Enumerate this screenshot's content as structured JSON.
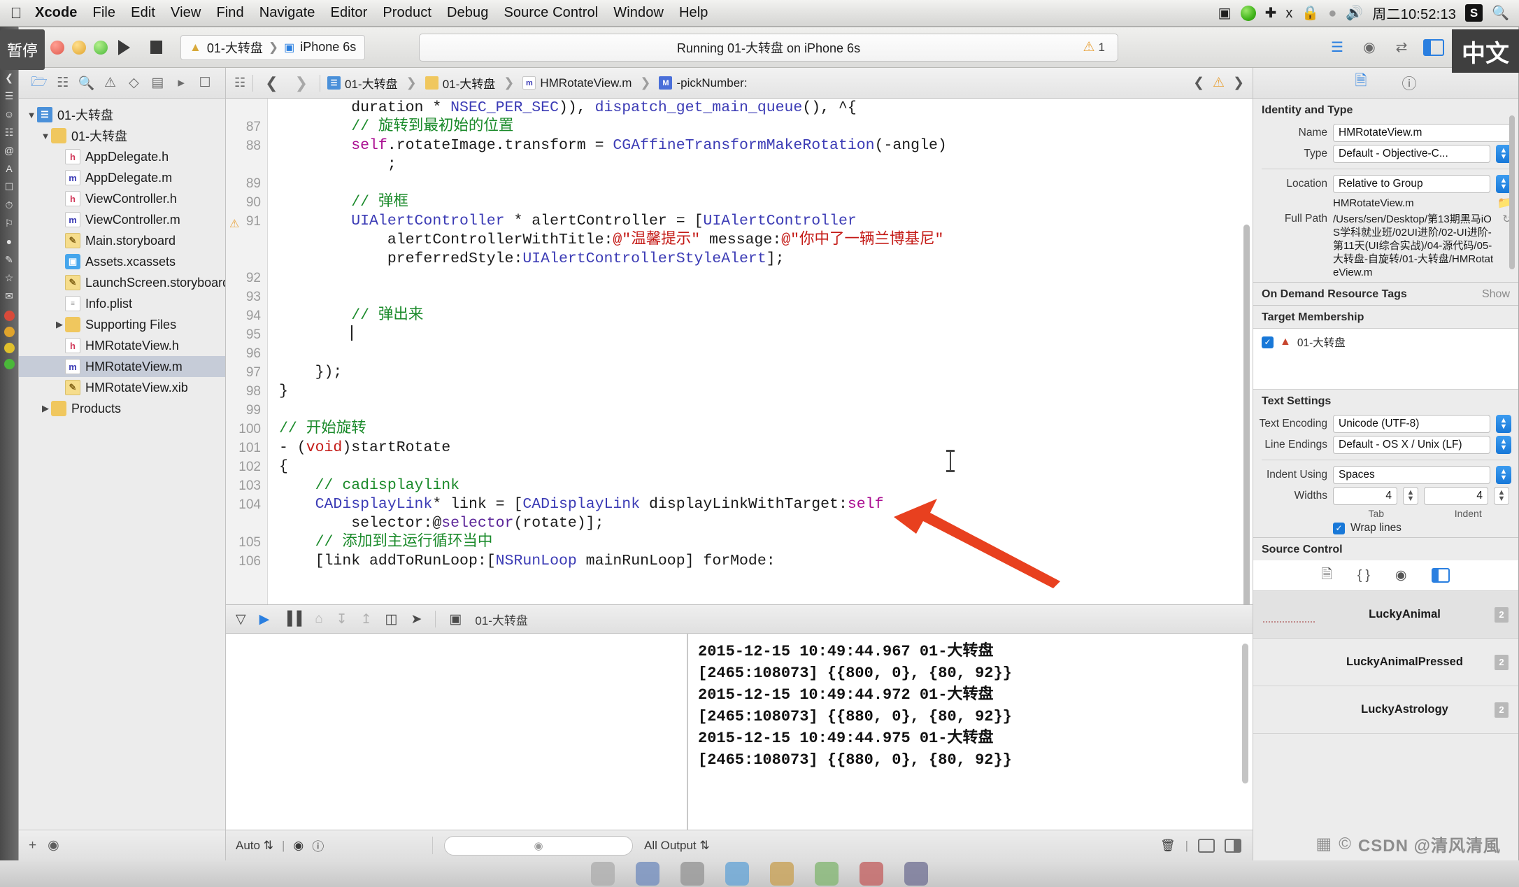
{
  "menubar": {
    "apple_icon": "apple-icon",
    "items": [
      "Xcode",
      "File",
      "Edit",
      "View",
      "Find",
      "Navigate",
      "Editor",
      "Product",
      "Debug",
      "Source Control",
      "Window",
      "Help"
    ],
    "status_icons": [
      "screen-record-icon",
      "play-circle-icon",
      "airplay-icon",
      "bluetooth-icon",
      "lock-icon",
      "location-icon",
      "volume-icon"
    ],
    "clock": "周二10:52:13",
    "ime_badge": "S",
    "search_icon": "search-icon"
  },
  "pause_tooltip": "暂停",
  "ime_overlay": "中文",
  "toolbar": {
    "run_button": "run-button",
    "stop_button": "stop-button",
    "scheme_target": "01-大转盘",
    "scheme_device": "iPhone 6s",
    "status_text": "Running 01-大转盘 on iPhone 6s",
    "warning_count": "1",
    "editor_icons": [
      "standard-editor-icon",
      "assistant-editor-icon",
      "version-editor-icon"
    ],
    "panel_icons": [
      "toggle-navigator-icon",
      "toggle-debug-icon",
      "toggle-inspector-icon"
    ]
  },
  "navigator": {
    "tabs": [
      "folder-icon",
      "source-control-icon",
      "search-icon",
      "warning-icon",
      "test-icon",
      "debug-icon",
      "breakpoint-icon",
      "report-icon"
    ],
    "active_tab": 0,
    "items": [
      {
        "label": "01-大转盘",
        "icon": "project-icon",
        "indent": 0,
        "twisty": "▼",
        "selected": false
      },
      {
        "label": "01-大转盘",
        "icon": "folder-icon",
        "indent": 1,
        "twisty": "▼",
        "selected": false
      },
      {
        "label": "AppDelegate.h",
        "icon": "header-icon",
        "indent": 2,
        "twisty": "",
        "selected": false
      },
      {
        "label": "AppDelegate.m",
        "icon": "objc-icon",
        "indent": 2,
        "twisty": "",
        "selected": false
      },
      {
        "label": "ViewController.h",
        "icon": "header-icon",
        "indent": 2,
        "twisty": "",
        "selected": false
      },
      {
        "label": "ViewController.m",
        "icon": "objc-icon",
        "indent": 2,
        "twisty": "",
        "selected": false
      },
      {
        "label": "Main.storyboard",
        "icon": "storyboard-icon",
        "indent": 2,
        "twisty": "",
        "selected": false
      },
      {
        "label": "Assets.xcassets",
        "icon": "assets-icon",
        "indent": 2,
        "twisty": "",
        "selected": false
      },
      {
        "label": "LaunchScreen.storyboard",
        "icon": "storyboard-icon",
        "indent": 2,
        "twisty": "",
        "selected": false
      },
      {
        "label": "Info.plist",
        "icon": "plist-icon",
        "indent": 2,
        "twisty": "",
        "selected": false
      },
      {
        "label": "Supporting Files",
        "icon": "folder-icon",
        "indent": 2,
        "twisty": "▶",
        "selected": false
      },
      {
        "label": "HMRotateView.h",
        "icon": "header-icon",
        "indent": 2,
        "twisty": "",
        "selected": false
      },
      {
        "label": "HMRotateView.m",
        "icon": "objc-icon",
        "indent": 2,
        "twisty": "",
        "selected": true
      },
      {
        "label": "HMRotateView.xib",
        "icon": "xib-icon",
        "indent": 2,
        "twisty": "",
        "selected": false
      },
      {
        "label": "Products",
        "icon": "folder-icon",
        "indent": 1,
        "twisty": "▶",
        "selected": false
      }
    ],
    "footer_icons": [
      "add-icon",
      "filter-icon"
    ]
  },
  "jumpbar": {
    "related_icon": "related-items-icon",
    "back_icon": "back-chevron-icon",
    "forward_icon": "forward-chevron-icon",
    "crumbs": [
      {
        "label": "01-大转盘",
        "icon": "project-icon"
      },
      {
        "label": "01-大转盘",
        "icon": "folder-icon"
      },
      {
        "label": "HMRotateView.m",
        "icon": "objc-icon"
      },
      {
        "label": "-pickNumber:",
        "icon": "method-icon"
      }
    ],
    "right_icons": [
      "prev-issue-icon",
      "warning-icon",
      "next-issue-icon"
    ]
  },
  "code": {
    "lines": [
      {
        "num": "",
        "warn": false,
        "indent": 8,
        "html": "duration * NSEC_PER_SEC)), dispatch_get_main_queue(), ^{"
      },
      {
        "num": "87",
        "warn": false,
        "indent": 8,
        "html": "// 旋转到最初始的位置"
      },
      {
        "num": "88",
        "warn": false,
        "indent": 8,
        "html": "self.rotateImage.transform = CGAffineTransformMakeRotation(-angle)"
      },
      {
        "num": "",
        "warn": false,
        "indent": 12,
        "html": ";"
      },
      {
        "num": "89",
        "warn": false,
        "indent": 0,
        "html": ""
      },
      {
        "num": "90",
        "warn": false,
        "indent": 8,
        "html": "// 弹框"
      },
      {
        "num": "91",
        "warn": true,
        "indent": 8,
        "html": "UIAlertController * alertController = [UIAlertController"
      },
      {
        "num": "",
        "warn": false,
        "indent": 12,
        "html": "alertControllerWithTitle:@\"温馨提示\" message:@\"你中了一辆兰博基尼\""
      },
      {
        "num": "",
        "warn": false,
        "indent": 12,
        "html": "preferredStyle:UIAlertControllerStyleAlert];"
      },
      {
        "num": "92",
        "warn": false,
        "indent": 0,
        "html": ""
      },
      {
        "num": "93",
        "warn": false,
        "indent": 0,
        "html": ""
      },
      {
        "num": "94",
        "warn": false,
        "indent": 8,
        "html": "// 弹出来"
      },
      {
        "num": "95",
        "warn": false,
        "indent": 8,
        "html": "CARET"
      },
      {
        "num": "96",
        "warn": false,
        "indent": 0,
        "html": ""
      },
      {
        "num": "97",
        "warn": false,
        "indent": 4,
        "html": "});"
      },
      {
        "num": "98",
        "warn": false,
        "indent": 0,
        "html": "}"
      },
      {
        "num": "99",
        "warn": false,
        "indent": 0,
        "html": ""
      },
      {
        "num": "100",
        "warn": false,
        "indent": 0,
        "html": "// 开始旋转"
      },
      {
        "num": "101",
        "warn": false,
        "indent": 0,
        "html": "- (void)startRotate"
      },
      {
        "num": "102",
        "warn": false,
        "indent": 0,
        "html": "{"
      },
      {
        "num": "103",
        "warn": false,
        "indent": 4,
        "html": "// cadisplaylink"
      },
      {
        "num": "104",
        "warn": false,
        "indent": 4,
        "html": "CADisplayLink* link = [CADisplayLink displayLinkWithTarget:self"
      },
      {
        "num": "",
        "warn": false,
        "indent": 8,
        "html": "selector:@selector(rotate)];"
      },
      {
        "num": "105",
        "warn": false,
        "indent": 4,
        "html": "// 添加到主运行循环当中"
      },
      {
        "num": "106",
        "warn": false,
        "indent": 4,
        "html": "[link addToRunLoop:[NSRunLoop mainRunLoop] forMode:"
      }
    ]
  },
  "debugbar": {
    "icons": [
      "hide-debug-icon",
      "continue-icon",
      "step-over-icon",
      "step-into-icon",
      "step-out-icon",
      "simulate-location-icon",
      "view-hierarchy-icon",
      "device-icon"
    ],
    "process_label": "01-大转盘"
  },
  "console": {
    "lines": [
      "2015-12-15 10:49:44.967 01-大转盘",
      "[2465:108073] {{800, 0}, {80, 92}}",
      "2015-12-15 10:49:44.972 01-大转盘",
      "[2465:108073] {{880, 0}, {80, 92}}",
      "2015-12-15 10:49:44.975 01-大转盘",
      "[2465:108073] {{880, 0}, {80, 92}}"
    ]
  },
  "statusbar": {
    "auto_label": "Auto",
    "filter_placeholder": "",
    "output_label": "All Output",
    "trash_icon": "trash-icon",
    "panel_icons": [
      "split-console-icon",
      "split-both-icon"
    ],
    "nav_icons": [
      "eye-icon",
      "info-icon"
    ]
  },
  "inspector": {
    "tabs": [
      "file-inspector-icon",
      "quick-help-icon"
    ],
    "active_tab": 0,
    "identity_section": "Identity and Type",
    "fields": [
      {
        "label": "Name",
        "value": "HMRotateView.m",
        "type": "text"
      },
      {
        "label": "Type",
        "value": "Default - Objective-C...",
        "type": "popup"
      },
      {
        "label": "Location",
        "value": "Relative to Group",
        "type": "popup"
      }
    ],
    "location_file": "HMRotateView.m",
    "full_path_label": "Full Path",
    "full_path": "/Users/sen/Desktop/第13期黑马iOS学科就业班/02UI进阶/02-UI进阶-第11天(UI综合实战)/04-源代码/05-大转盘-自旋转/01-大转盘/HMRotateView.m",
    "odr_section": "On Demand Resource Tags",
    "odr_show": "Show",
    "target_section": "Target Membership",
    "target_item": "01-大转盘",
    "target_checked": true,
    "text_settings_section": "Text Settings",
    "text_fields": [
      {
        "label": "Text Encoding",
        "value": "Unicode (UTF-8)",
        "type": "popup"
      },
      {
        "label": "Line Endings",
        "value": "Default - OS X / Unix (LF)",
        "type": "popup"
      },
      {
        "label": "Indent Using",
        "value": "Spaces",
        "type": "popup"
      }
    ],
    "widths_label": "Widths",
    "tab_width": "4",
    "indent_width": "4",
    "tab_caption": "Tab",
    "indent_caption": "Indent",
    "wrap_lines_label": "Wrap lines",
    "wrap_lines_checked": true,
    "source_control_section": "Source Control",
    "sc_icons": [
      "file-icon",
      "braces-icon",
      "target-icon",
      "panel-icon"
    ],
    "assets": [
      {
        "name": "LuckyAnimal",
        "badge": "2",
        "selected": true
      },
      {
        "name": "LuckyAnimalPressed",
        "badge": "2",
        "selected": false
      },
      {
        "name": "LuckyAstrology",
        "badge": "2",
        "selected": false
      }
    ]
  },
  "watermark": {
    "grid_icon": "grid-icon",
    "copyright": "CSDN @清风清風"
  },
  "colors": {
    "accent_blue": "#2a7fe0",
    "selection": "#c6ccd8",
    "comment_green": "#1a8a2a",
    "string_red": "#c41a16",
    "keyword_purple": "#aa0d91",
    "type_blue": "#3b3bb5",
    "arrow_red": "#e8401f"
  }
}
